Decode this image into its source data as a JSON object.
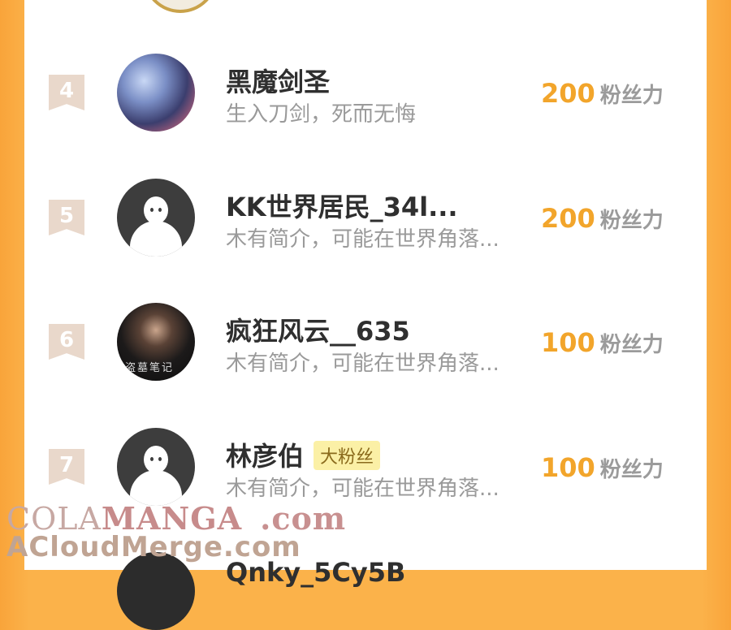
{
  "ranking": {
    "unit_label": "粉丝力",
    "rows": [
      {
        "rank": "4",
        "name": "黑魔剑圣",
        "badge": "",
        "bio": "生入刀剑，死而无悔",
        "score": "200"
      },
      {
        "rank": "5",
        "name": "KK世界居民_34l...",
        "badge": "",
        "bio": "木有简介，可能在世界角落...",
        "score": "200"
      },
      {
        "rank": "6",
        "name": "疯狂风云__635",
        "badge": "",
        "bio": "木有简介，可能在世界角落...",
        "score": "100"
      },
      {
        "rank": "7",
        "name": "林彦伯",
        "badge": "大粉丝",
        "bio": "木有简介，可能在世界角落...",
        "score": "100"
      }
    ],
    "next_row_name": "Qnky_5Cy5B"
  },
  "avatar_caption": "盗墓笔记",
  "watermark": {
    "line1_a": "COLA",
    "line1_b": "MANGA",
    "line1_c": ".com",
    "line2": "ACloudMerge.com"
  },
  "colors": {
    "score": "#f2a52b",
    "background": "#fbb24a",
    "rank_badge": "#e9d8cb"
  }
}
